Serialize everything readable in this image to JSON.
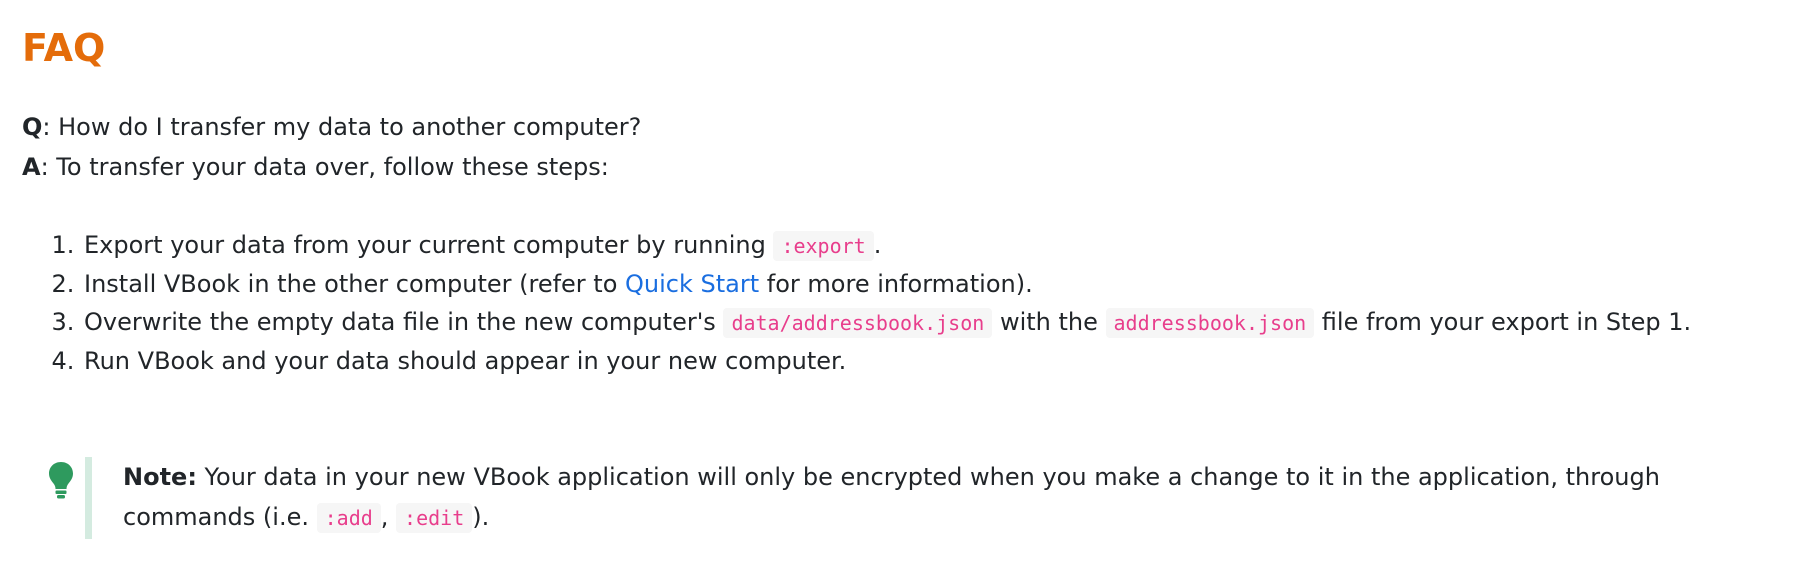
{
  "heading": "FAQ",
  "question": {
    "label": "Q",
    "text": ": How do I transfer my data to another computer?"
  },
  "answer": {
    "label": "A",
    "text": ": To transfer your data over, follow these steps:"
  },
  "steps": [
    {
      "before": "Export your data from your current computer by running ",
      "code": ":export",
      "after": "."
    },
    {
      "before": "Install VBook in the other computer (refer to ",
      "link": "Quick Start",
      "after": " for more information)."
    },
    {
      "before": "Overwrite the empty data file in the new computer's ",
      "code1": "data/addressbook.json",
      "middle": " with the ",
      "code2": "addressbook.json",
      "after": " file from your export in Step 1."
    },
    {
      "text": "Run VBook and your data should appear in your new computer."
    }
  ],
  "note": {
    "icon": "lightbulb-icon",
    "label": "Note:",
    "text": " Your data in your new VBook application will only be encrypted when you make a change to it in the application, through commands (i.e. ",
    "code1": ":add",
    "separator": ", ",
    "code2": ":edit",
    "after": ")."
  },
  "colors": {
    "heading": "#e46c0a",
    "link": "#1a6ee0",
    "code_text": "#e83e8c",
    "code_bg": "#f6f6f6",
    "note_bar": "#d4ebe0",
    "note_icon": "#2e9a5e"
  }
}
